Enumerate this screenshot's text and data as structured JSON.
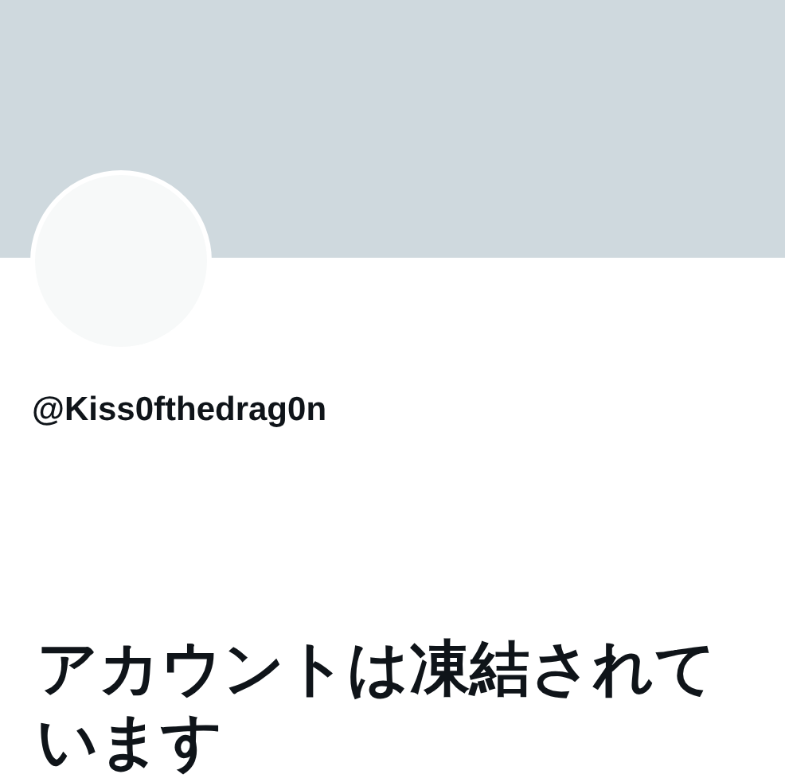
{
  "profile": {
    "handle": "@Kiss0fthedrag0n"
  },
  "notice": {
    "title": "アカウントは凍結されています"
  }
}
